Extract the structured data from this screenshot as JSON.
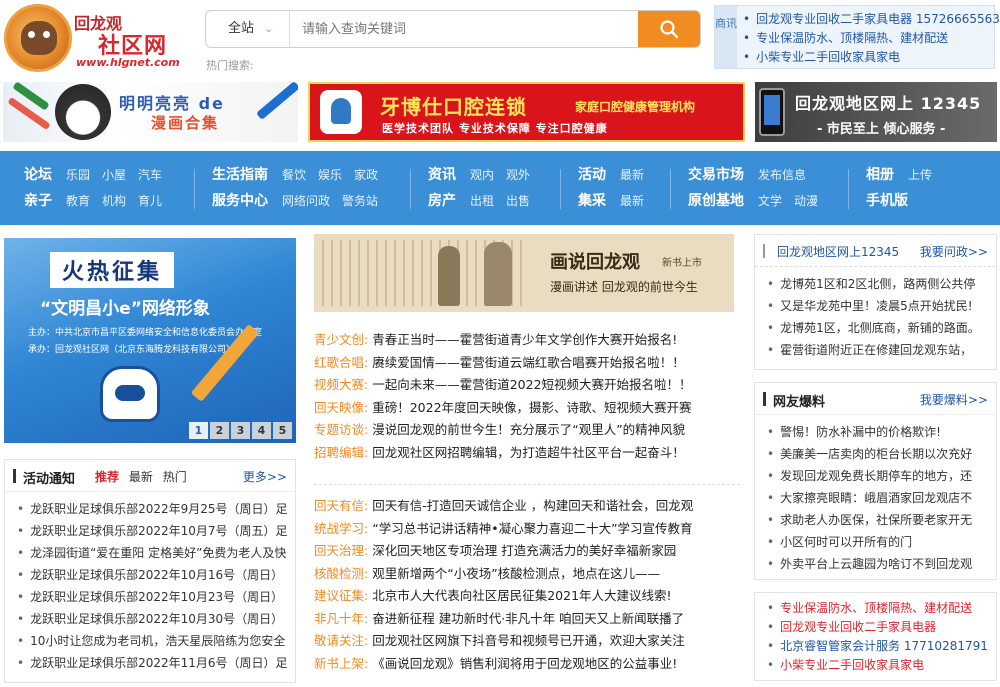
{
  "header": {
    "logo_line1": "回龙观",
    "logo_line2": "社区网",
    "logo_domain": "www.hlgnet.com",
    "search_scope": "全站",
    "search_placeholder": "请输入查询关键词",
    "hot_search_label": "热门搜索:"
  },
  "business_box": {
    "tag": "商讯",
    "items": [
      "回龙观专业回收二手家具电器 15726665563",
      "专业保温防水、顶楼隔热、建材配送",
      "小柴专业二手回收家具家电"
    ]
  },
  "banners": {
    "left": {
      "title": "明明亮亮 de",
      "subtitle": "漫画合集"
    },
    "middle": {
      "title": "牙博仕口腔连锁",
      "slogan": "家庭口腔健康管理机构",
      "tagline": "医学技术团队  专业技术保障  专注口腔健康"
    },
    "right": {
      "title": "回龙观地区网上 12345",
      "subtitle": "- 市民至上  倾心服务 -"
    }
  },
  "nav": {
    "groups": [
      {
        "row1": {
          "main": "论坛",
          "subs": [
            "乐园",
            "小屋",
            "汽车"
          ]
        },
        "row2": {
          "main": "亲子",
          "subs": [
            "教育",
            "机构",
            "育儿"
          ]
        }
      },
      {
        "row1": {
          "main": "生活指南",
          "subs": [
            "餐饮",
            "娱乐",
            "家政"
          ]
        },
        "row2": {
          "main": "服务中心",
          "subs": [
            "网络问政",
            "警务站"
          ]
        }
      },
      {
        "row1": {
          "main": "资讯",
          "subs": [
            "观内",
            "观外"
          ]
        },
        "row2": {
          "main": "房产",
          "subs": [
            "出租",
            "出售"
          ]
        }
      },
      {
        "row1": {
          "main": "活动",
          "subs": [
            "最新"
          ]
        },
        "row2": {
          "main": "集采",
          "subs": [
            "最新"
          ]
        }
      },
      {
        "row1": {
          "main": "交易市场",
          "subs": [
            "发布信息"
          ]
        },
        "row2": {
          "main": "原创基地",
          "subs": [
            "文学",
            "动漫"
          ]
        }
      },
      {
        "row1": {
          "main": "相册",
          "subs": [
            "上传"
          ]
        },
        "row2": {
          "main": "手机版",
          "subs": []
        }
      }
    ]
  },
  "promo": {
    "title": "火热征集",
    "subtitle": "“文明昌小e”网络形象",
    "organizer": "主办：中共北京市昌平区委网络安全和信息化委员会办公室",
    "host": "承办：回龙观社区网（北京东海腾龙科技有限公司）",
    "pages": [
      "1",
      "2",
      "3",
      "4",
      "5"
    ]
  },
  "events": {
    "title": "活动通知",
    "tabs": [
      "推荐",
      "最新",
      "热门"
    ],
    "more": "更多>>",
    "items": [
      "龙跃职业足球俱乐部2022年9月25号（周日）足",
      "龙跃职业足球俱乐部2022年10月7号（周五）足",
      "龙泽园街道“爱在重阳 定格美好”免费为老人及快",
      "龙跃职业足球俱乐部2022年10月16号（周日）",
      "龙跃职业足球俱乐部2022年10月23号（周日）",
      "龙跃职业足球俱乐部2022年10月30号（周日）",
      "10小时让您成为老司机，浩天星辰陪练为您安全",
      "龙跃职业足球俱乐部2022年11月6号（周日）足"
    ]
  },
  "book": {
    "title": "画说回龙观",
    "badge": "新书上市",
    "subtitle": "漫画讲述  回龙观的前世今生"
  },
  "news_top": [
    {
      "cat": "青少文创:",
      "text": "青春正当时——霍营街道青少年文学创作大赛开始报名!"
    },
    {
      "cat": "红歌合唱:",
      "text": "赓续爱国情——霍营街道云端红歌合唱赛开始报名啦！！"
    },
    {
      "cat": "视频大赛:",
      "text": "一起向未来——霍营街道2022短视频大赛开始报名啦！！"
    },
    {
      "cat": "回天映像:",
      "text": "重磅！2022年度回天映像，摄影、诗歌、短视频大赛开赛"
    },
    {
      "cat": "专题访谈:",
      "text": "漫说回龙观的前世今生！充分展示了“观里人”的精神风貌"
    },
    {
      "cat": "招聘编辑:",
      "text": "回龙观社区网招聘编辑，为打造超牛社区平台一起奋斗！"
    }
  ],
  "news_bottom": [
    {
      "cat": "回天有信:",
      "text": "回天有信-打造回天诚信企业 ，构建回天和谐社会，回龙观"
    },
    {
      "cat": "统战学习:",
      "text": "“学习总书记讲话精神•凝心聚力喜迎二十大”学习宣传教育"
    },
    {
      "cat": "回天治理:",
      "text": "深化回天地区专项治理 打造充满活力的美好幸福新家园"
    },
    {
      "cat": "核酸检测:",
      "text": "观里新增两个“小夜场”核酸检测点，地点在这儿——"
    },
    {
      "cat": "建议征集:",
      "text": "北京市人大代表向社区居民征集2021年人大建议线索!"
    },
    {
      "cat": "非凡十年:",
      "text": "奋进新征程 建功新时代·非凡十年 咱回天又上新闻联播了"
    },
    {
      "cat": "敬请关注:",
      "text": "回龙观社区网旗下抖音号和视频号已开通，欢迎大家关注"
    },
    {
      "cat": "新书上架:",
      "text": "《画说回龙观》销售利润将用于回龙观地区的公益事业!"
    }
  ],
  "right_box1": {
    "title": "回龙观地区网上12345",
    "more": "我要问政>>",
    "items": [
      "龙博苑1区和2区北侧，路两侧公共停",
      "又是华龙苑中里！凌晨5点开始扰民!",
      "龙博苑1区，北侧底商，新铺的路面。",
      "霍营街道附近正在修建回龙观东站，"
    ]
  },
  "right_box2": {
    "title": "网友爆料",
    "more": "我要爆料>>",
    "items": [
      "警惕！防水补漏中的价格欺诈!",
      "美廉美一店卖肉的柜台长期以次充好",
      "发现回龙观免费长期停车的地方，还",
      "大家擦亮眼睛：峨眉酒家回龙观店不",
      "求助老人办医保，社保所要老家开无",
      "小区何时可以开所有的门",
      "外卖平台上云趣园为啥订不到回龙观"
    ]
  },
  "right_box3": {
    "items": [
      "专业保温防水、顶楼隔热、建材配送",
      "回龙观专业回收二手家具电器",
      "北京睿智管家会计服务 17710281791",
      "小柴专业二手回收家具家电"
    ]
  },
  "colors": {
    "nav_bg": "#3b8fd6",
    "accent_orange": "#f18c21",
    "brand_red": "#d9262c",
    "link_blue": "#1f57a4"
  }
}
